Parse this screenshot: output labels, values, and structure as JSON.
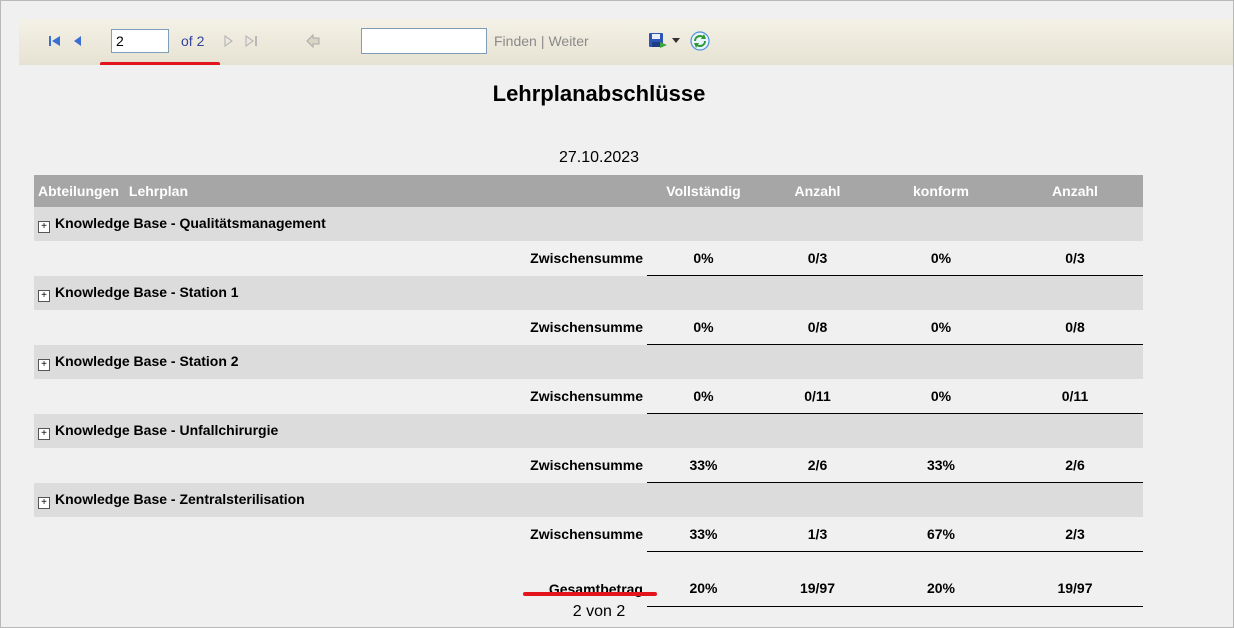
{
  "toolbar": {
    "page_value": "2",
    "page_of": "of 2",
    "find_placeholder": "",
    "find_label": "Finden",
    "separator": "|",
    "next_label": "Weiter",
    "icons": [
      "first-page-icon",
      "previous-page-icon",
      "next-page-icon",
      "last-page-icon",
      "back-icon",
      "export-icon",
      "dropdown-arrow-icon",
      "refresh-icon"
    ]
  },
  "report": {
    "title": "Lehrplanabschlüsse",
    "date": "27.10.2023",
    "headers": {
      "abteilungen": "Abteilungen",
      "lehrplan": "Lehrplan",
      "vollstaendig": "Vollständig",
      "anzahl1": "Anzahl",
      "konform": "konform",
      "anzahl2": "Anzahl"
    },
    "groups": [
      {
        "name": "Knowledge Base - Qualitätsmanagement",
        "subtotal_label": "Zwischensumme",
        "vollstaendig": "0%",
        "anzahl1": "0/3",
        "konform": "0%",
        "anzahl2": "0/3"
      },
      {
        "name": "Knowledge Base - Station 1",
        "subtotal_label": "Zwischensumme",
        "vollstaendig": "0%",
        "anzahl1": "0/8",
        "konform": "0%",
        "anzahl2": "0/8"
      },
      {
        "name": "Knowledge Base - Station 2",
        "subtotal_label": "Zwischensumme",
        "vollstaendig": "0%",
        "anzahl1": "0/11",
        "konform": "0%",
        "anzahl2": "0/11"
      },
      {
        "name": "Knowledge Base - Unfallchirurgie",
        "subtotal_label": "Zwischensumme",
        "vollstaendig": "33%",
        "anzahl1": "2/6",
        "konform": "33%",
        "anzahl2": "2/6"
      },
      {
        "name": "Knowledge Base - Zentralsterilisation",
        "subtotal_label": "Zwischensumme",
        "vollstaendig": "33%",
        "anzahl1": "1/3",
        "konform": "67%",
        "anzahl2": "2/3"
      }
    ],
    "total": {
      "label": "Gesamtbetrag",
      "vollstaendig": "20%",
      "anzahl1": "19/97",
      "konform": "20%",
      "anzahl2": "19/97"
    },
    "footer": "2 von 2"
  },
  "colors": {
    "header_bg": "#a6a6a6",
    "group_bg": "#dcdcdc",
    "annotation_red": "#e3141b",
    "nav_blue": "#3b6fd4"
  }
}
